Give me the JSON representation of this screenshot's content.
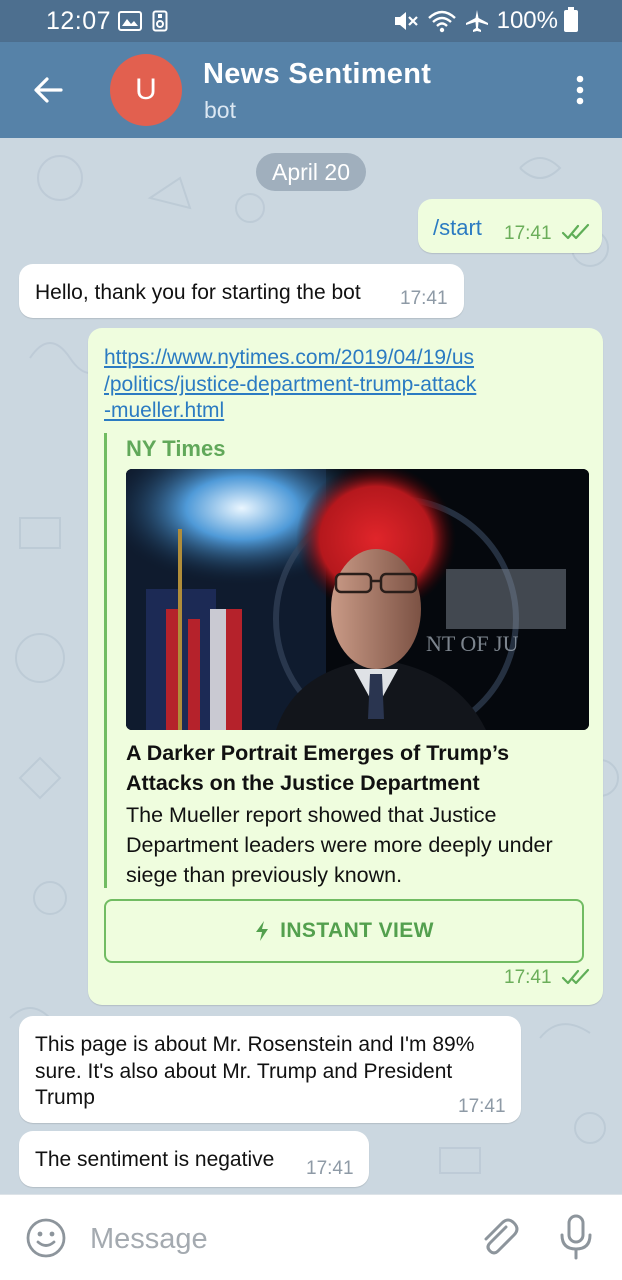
{
  "status_bar": {
    "time": "12:07",
    "battery": "100%",
    "icons": [
      "gallery-icon",
      "sim-icon",
      "mute-icon",
      "wifi-icon",
      "airplane-icon",
      "battery-icon"
    ]
  },
  "header": {
    "avatar_letter": "U",
    "title": "News Sentiment",
    "subtitle": "bot"
  },
  "chat": {
    "date_label": "April 20",
    "messages": [
      {
        "dir": "out",
        "text": "/start",
        "time": "17:41"
      },
      {
        "dir": "in",
        "text": "Hello, thank you for starting the bot",
        "time": "17:41"
      },
      {
        "dir": "out",
        "link_lines": [
          "https://www.nytimes.com/2019/04/19/us",
          "/politics/justice-department-trump-attack",
          "-mueller.html"
        ],
        "preview": {
          "site": "NY Times",
          "title": "A Darker Portrait Emerges of Trump’s Attacks on the Justice Department",
          "description": "The Mueller report showed that Justice Department leaders were more deeply under siege than previously known."
        },
        "button": "INSTANT VIEW",
        "time": "17:41"
      },
      {
        "dir": "in",
        "text": "This page is about Mr. Rosenstein and I'm 89% sure. It's also about Mr. Trump and President Trump",
        "time": "17:41"
      },
      {
        "dir": "in",
        "text": "The sentiment is negative",
        "time": "17:41"
      }
    ]
  },
  "input": {
    "placeholder": "Message"
  },
  "colors": {
    "status_bar": "#4d6f8f",
    "header": "#5682a8",
    "avatar": "#e2604f",
    "outgoing_bubble": "#effdde",
    "incoming_bubble": "#ffffff",
    "link": "#2b7bc2",
    "accent_green": "#71bc62"
  }
}
